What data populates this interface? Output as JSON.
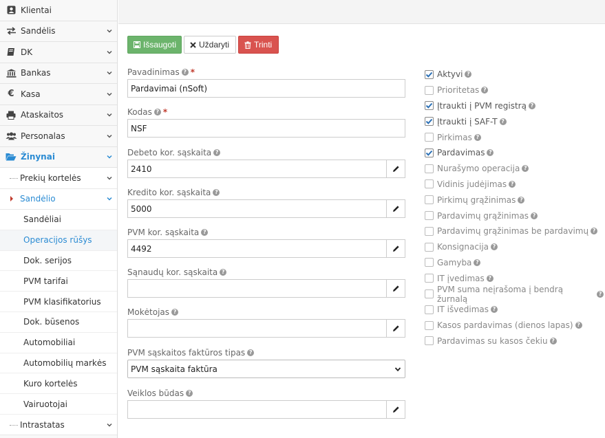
{
  "sidebar": {
    "items": [
      {
        "label": "Klientai",
        "icon": "user-card-icon",
        "chevron": false
      },
      {
        "label": "Sandėlis",
        "icon": "exchange-icon",
        "chevron": true
      },
      {
        "label": "DK",
        "icon": "book-icon",
        "chevron": true
      },
      {
        "label": "Bankas",
        "icon": "bank-icon",
        "chevron": true
      },
      {
        "label": "Kasa",
        "icon": "euro-icon",
        "chevron": true
      },
      {
        "label": "Ataskaitos",
        "icon": "print-icon",
        "chevron": true
      },
      {
        "label": "Personalas",
        "icon": "users-icon",
        "chevron": true
      },
      {
        "label": "Žinynai",
        "icon": "folder-open-icon",
        "chevron": true
      }
    ],
    "sub_items": [
      {
        "label": "Prekių kortelės"
      },
      {
        "label": "Sandėlio"
      }
    ],
    "subsub_items": [
      {
        "label": "Sandėliai"
      },
      {
        "label": "Operacijos rūšys"
      },
      {
        "label": "Dok. serijos"
      },
      {
        "label": "PVM tarifai"
      },
      {
        "label": "PVM klasifikatorius"
      },
      {
        "label": "Dok. būsenos"
      },
      {
        "label": "Automobiliai"
      },
      {
        "label": "Automobilių markės"
      },
      {
        "label": "Kuro kortelės"
      },
      {
        "label": "Vairuotojai"
      }
    ],
    "bottom_item": {
      "label": "Intrastatas"
    }
  },
  "toolbar": {
    "save_label": "Išsaugoti",
    "close_label": "Uždaryti",
    "delete_label": "Trinti"
  },
  "form": {
    "name": {
      "label": "Pavadinimas",
      "value": "Pardavimai (nSoft)"
    },
    "code": {
      "label": "Kodas",
      "value": "NSF"
    },
    "debit": {
      "label": "Debeto kor. sąskaita",
      "value": "2410"
    },
    "credit": {
      "label": "Kredito kor. sąskaita",
      "value": "5000"
    },
    "vat": {
      "label": "PVM kor. sąskaita",
      "value": "4492"
    },
    "cost": {
      "label": "Sąnaudų kor. sąskaita",
      "value": ""
    },
    "payer": {
      "label": "Mokėtojas",
      "value": ""
    },
    "invoice_type": {
      "label": "PVM sąskaitos faktūros tipas",
      "value": "PVM sąskaita faktūra"
    },
    "activity": {
      "label": "Veiklos būdas",
      "value": ""
    }
  },
  "checks": [
    {
      "label": "Aktyvi",
      "checked": true
    },
    {
      "label": "Prioritetas",
      "checked": false
    },
    {
      "label": "Įtraukti į PVM registrą",
      "checked": true
    },
    {
      "label": "Įtraukti į SAF-T",
      "checked": true
    },
    {
      "label": "Pirkimas",
      "checked": false
    },
    {
      "label": "Pardavimas",
      "checked": true
    },
    {
      "label": "Nurašymo operacija",
      "checked": false
    },
    {
      "label": "Vidinis judėjimas",
      "checked": false
    },
    {
      "label": "Pirkimų grąžinimas",
      "checked": false
    },
    {
      "label": "Pardavimų grąžinimas",
      "checked": false
    },
    {
      "label": "Pardavimų grąžinimas be pardavimų",
      "checked": false
    },
    {
      "label": "Konsignacija",
      "checked": false
    },
    {
      "label": "Gamyba",
      "checked": false
    },
    {
      "label": "IT įvedimas",
      "checked": false
    },
    {
      "label": "PVM suma neįrašoma į bendrą žurnalą",
      "checked": false
    },
    {
      "label": "IT išvedimas",
      "checked": false
    },
    {
      "label": "Kasos pardavimas (dienos lapas)",
      "checked": false
    },
    {
      "label": "Pardavimas su kasos čekiu",
      "checked": false
    }
  ],
  "colors": {
    "accent": "#2a8bd3",
    "save": "#6cb46c",
    "delete": "#d9534f",
    "required": "#c0392b"
  }
}
